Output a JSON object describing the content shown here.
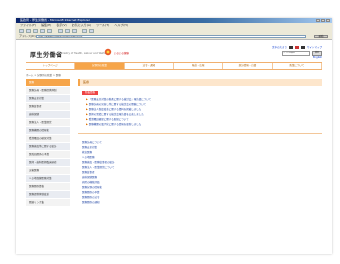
{
  "window": {
    "title": "医政局 - 厚生労働省 - Microsoft Internet Explorer"
  },
  "menubar": [
    "ファイル(F)",
    "編集(E)",
    "表示(V)",
    "お気に入り(A)",
    "ツール(T)",
    "ヘルプ(H)"
  ],
  "address": {
    "label": "アドレス(D)",
    "url": "http://www.mhlw.go.jp/bunya/iryou/",
    "go_label": "移動"
  },
  "header": {
    "logo": "厚生労働省",
    "logo_sub": "Ministry of Health, Labour and Welfare",
    "emblem_text": "いきいき健康",
    "util_links": [
      "文字の大きさ",
      "サイトマップ"
    ],
    "search_placeholder": "サイト内検索",
    "search_button": "検索",
    "site_link": "English"
  },
  "nav": {
    "tabs": [
      "トップページ",
      "分野別の政策",
      "法令・通知",
      "報道・広報",
      "統計情報・白書",
      "政策について"
    ]
  },
  "breadcrumb": "ホーム > 分野別の政策 > 医療",
  "sidebar": {
    "items": [
      "医療",
      "医療計画・医療提供体制",
      "医療安全対策",
      "医療従事者",
      "歯科保健",
      "医療法人・医業経営",
      "医療機関の情報化",
      "看護職員の確保対策",
      "医療施設等に関する統計",
      "医政局関係の予算",
      "医師・歯科医師臨床研修",
      "災害医療",
      "へき地保健医療対策",
      "医療関係資格",
      "医療提供体制改革",
      "関連リンク集"
    ]
  },
  "main": {
    "heading": "医療",
    "new_label": "新着情報",
    "news": [
      "「医療安全対策の推進に関する検討会」報告書について",
      "医療計画の見直し等に関する検討会の開催について",
      "医療法人制度改革に関する資料を掲載しました",
      "医師の需給に関する検討会報告書を公表しました",
      "看護職員確保に関する取組について",
      "医療機関の電子化に関する情報を更新しました"
    ],
    "links": [
      "医療計画について",
      "医療安全対策",
      "救急医療",
      "へき地医療",
      "医療施設・医療従事者の統計",
      "医療法人・医業経営について",
      "医療従事者",
      "歯科保健医療",
      "病院の機能評価",
      "医療分野の情報化",
      "医療関係の予算",
      "医療関係の法令",
      "医療関係の通知"
    ]
  }
}
